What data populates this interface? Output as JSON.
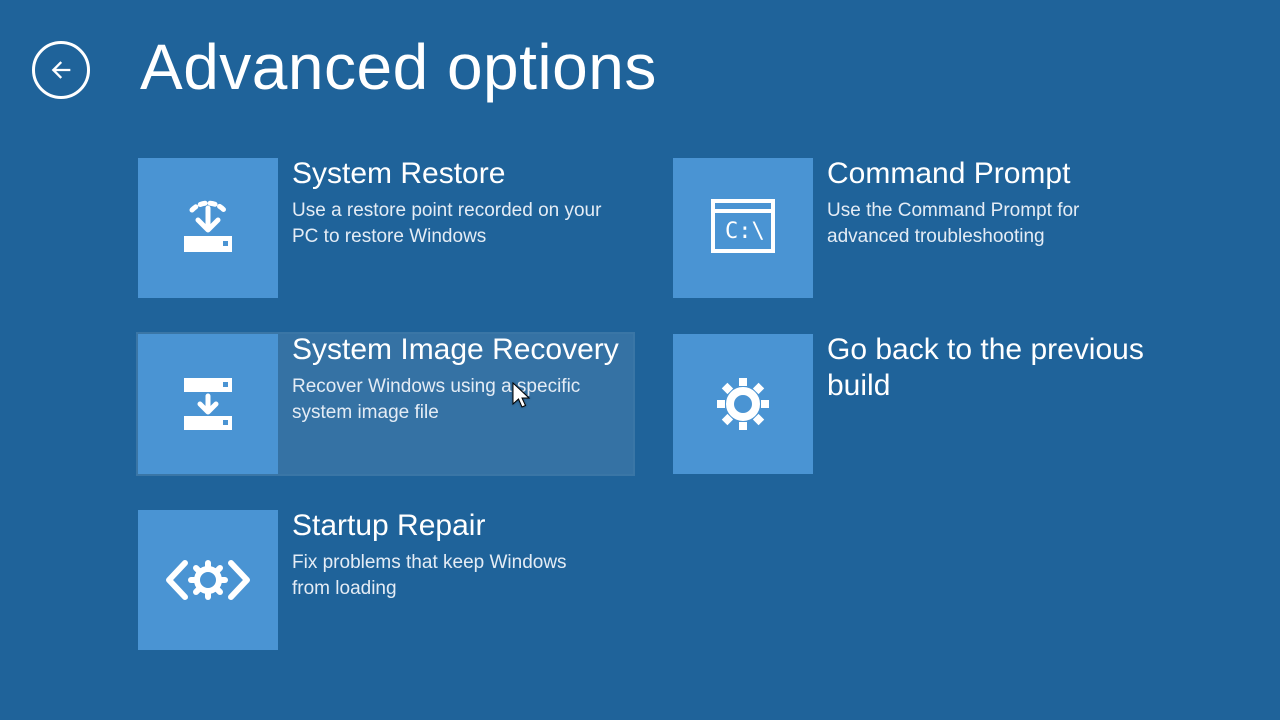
{
  "header": {
    "title": "Advanced options"
  },
  "tiles": [
    {
      "title": "System Restore",
      "desc": "Use a restore point recorded on your PC to restore Windows"
    },
    {
      "title": "System Image Recovery",
      "desc": "Recover Windows using a specific system image file"
    },
    {
      "title": "Startup Repair",
      "desc": "Fix problems that keep Windows from loading"
    },
    {
      "title": "Command Prompt",
      "desc": "Use the Command Prompt for advanced troubleshooting"
    },
    {
      "title": "Go back to the previous build",
      "desc": ""
    }
  ]
}
